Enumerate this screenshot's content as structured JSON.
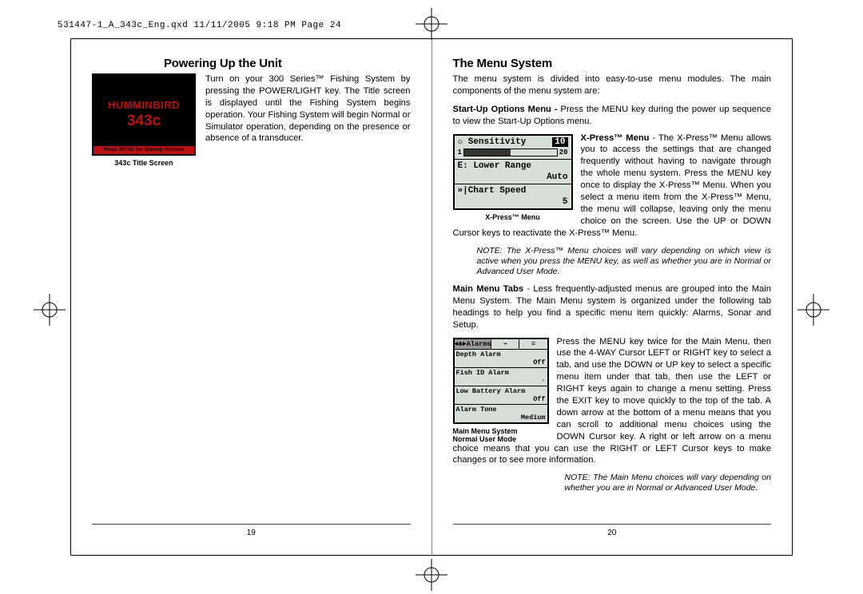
{
  "pageHeader": "531447-1_A_343c_Eng.qxd  11/11/2005  9:18 PM  Page 24",
  "left": {
    "heading": "Powering Up the Unit",
    "paragraph": "Turn on your 300 Series™ Fishing System by pressing the POWER/LIGHT key. The Title screen is displayed until the Fishing System begins operation. Your Fishing System will begin Normal or Simulator operation, depending on the presence or absence of a transducer.",
    "figCaption": "343c Title Screen",
    "titleScreen": {
      "brand": "HUMMINBIRD",
      "model": "343c",
      "bar": "Press MENU for Startup Options"
    },
    "pageNum": "19"
  },
  "right": {
    "heading": "The Menu System",
    "intro": "The menu system is divided into easy-to-use menu modules. The main components of the menu system are:",
    "startup": {
      "label": "Start-Up Options Menu - ",
      "text": "Press the MENU key during the power up sequence to view the Start-Up Options menu."
    },
    "xpress": {
      "label": "X-Press™ Menu",
      "text": " - The X-Press™ Menu allows you to access the settings that are changed frequently without having to navigate through the whole menu system. Press the MENU key once to display the X-Press™ Menu.  When you select a menu item from the X-Press™ Menu, the menu will collapse, leaving only the menu choice on the screen. Use the UP or DOWN Cursor keys to reactivate the X-Press™ Menu.",
      "figCaption": "X-Press™ Menu",
      "items": {
        "sensitivity": "Sensitivity",
        "sensVal": "10",
        "lower": "Lower Range",
        "lowerVal": "Auto",
        "chart": "Chart Speed",
        "chartVal": "5",
        "sliderMin": "1",
        "sliderMax": "20"
      }
    },
    "note1": "NOTE: The X-Press™ Menu choices will vary depending on which view is active when you press the MENU key, as well as whether you are in Normal or Advanced User Mode.",
    "mainTabs": {
      "label": "Main Menu Tabs",
      "text": " - Less frequently-adjusted menus are grouped into the Main Menu System. The Main Menu system is organized under the following tab headings to help you find a specific menu item quickly: Alarms, Sonar and Setup."
    },
    "mainPara": "Press the MENU key twice for the Main Menu, then use the 4-WAY Cursor LEFT or RIGHT key to select a tab, and use the DOWN or UP key to select a specific menu item under that tab, then use the LEFT or RIGHT keys again to change a menu setting. Press the EXIT key to move quickly to the top of the tab. A down arrow at the bottom of a menu means that you can scroll to additional menu choices using the DOWN Cursor key. A right or left arrow on a menu choice means that you can use the RIGHT or LEFT Cursor keys to make changes or to see more information.",
    "mainFig": {
      "caption1": "Main Menu System",
      "caption2": "Normal User Mode",
      "tabAlarms": "◄♣►Alarms",
      "row1": "Depth Alarm",
      "row1v": "Off",
      "row2": "Fish ID Alarm",
      "row2v": "◦",
      "row3": "Low Battery Alarm",
      "row3v": "Off",
      "row4": "Alarm Tone",
      "row4v": "Medium"
    },
    "note2": "NOTE: The Main Menu choices will vary depending on whether you are in Normal or Advanced User Mode.",
    "pageNum": "20"
  }
}
